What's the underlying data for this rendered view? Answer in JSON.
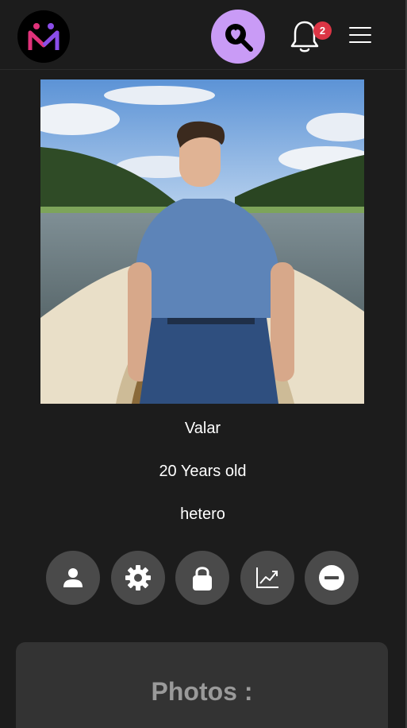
{
  "header": {
    "logo_icon": "match-logo-icon",
    "match_button_icon": "heart-search-icon",
    "notifications": {
      "icon": "bell-icon",
      "count": "2"
    },
    "menu_icon": "hamburger-menu-icon"
  },
  "profile": {
    "name": "Valar",
    "age": "20 Years old",
    "orientation": "hetero"
  },
  "actions": [
    {
      "icon": "user-icon"
    },
    {
      "icon": "gear-icon"
    },
    {
      "icon": "lock-icon"
    },
    {
      "icon": "chart-line-icon"
    },
    {
      "icon": "minus-circle-icon"
    }
  ],
  "photos_section": {
    "title": "Photos :"
  },
  "colors": {
    "background": "#1c1c1c",
    "accent": "#c99bf6",
    "badge": "#dc3545",
    "button": "#4a4a4a",
    "card": "#333333"
  }
}
